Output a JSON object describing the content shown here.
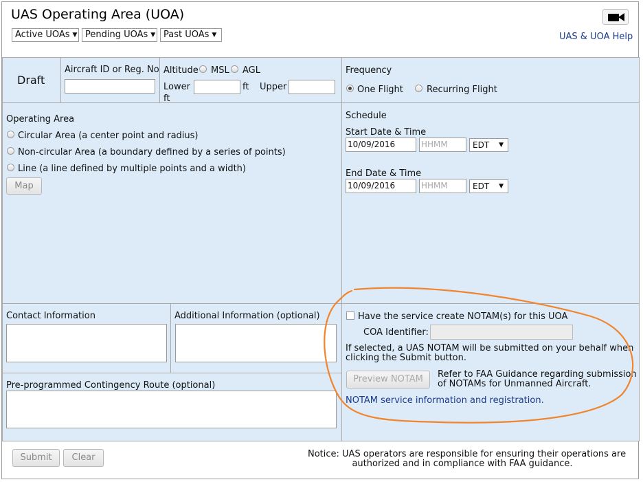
{
  "header": {
    "title": "UAS Operating Area (UOA)",
    "tabs": [
      {
        "label": "Active UOAs"
      },
      {
        "label": "Pending UOAs"
      },
      {
        "label": "Past UOAs"
      }
    ],
    "help_link": "UAS & UOA Help",
    "camera_icon": "video-camera-icon"
  },
  "status": {
    "label": "Draft"
  },
  "aircraft": {
    "label": "Aircraft ID or Reg. No.",
    "value": ""
  },
  "altitude": {
    "label": "Altitude",
    "options": [
      "MSL",
      "AGL"
    ],
    "lower_label": "Lower",
    "lower_unit": "ft",
    "upper_label": "Upper",
    "upper_unit": "ft",
    "lower_value": "",
    "upper_value": ""
  },
  "frequency": {
    "label": "Frequency",
    "options": [
      "One Flight",
      "Recurring Flight"
    ],
    "selected": "One Flight"
  },
  "operating_area": {
    "label": "Operating Area",
    "options": [
      "Circular Area (a center point and radius)",
      "Non-circular Area (a boundary defined by a series of points)",
      "Line (a line defined by multiple points and a width)"
    ],
    "map_button": "Map"
  },
  "schedule": {
    "label": "Schedule",
    "start_label": "Start Date & Time",
    "start_date": "10/09/2016",
    "start_time_placeholder": "HHMM",
    "start_tz": "EDT",
    "end_label": "End Date & Time",
    "end_date": "10/09/2016",
    "end_time_placeholder": "HHMM",
    "end_tz": "EDT"
  },
  "contact": {
    "label": "Contact Information",
    "value": ""
  },
  "additional": {
    "label": "Additional Information (optional)",
    "value": ""
  },
  "contingency": {
    "label": "Pre-programmed Contingency Route (optional)",
    "value": ""
  },
  "notam": {
    "checkbox_label": "Have the service create NOTAM(s) for this UOA",
    "coa_label": "COA Identifier:",
    "coa_value": "",
    "info_line1": "If selected, a UAS NOTAM will be submitted on your behalf when",
    "info_line2": "clicking the Submit button.",
    "preview_button": "Preview NOTAM",
    "guidance_line1": "Refer to FAA Guidance regarding submission",
    "guidance_line2": "of NOTAMs for Unmanned Aircraft.",
    "link": "NOTAM service information and registration.",
    "highlight_color": "#f0852d"
  },
  "footer": {
    "submit_button": "Submit",
    "clear_button": "Clear",
    "notice_line1": "Notice: UAS operators are responsible for ensuring their operations are",
    "notice_line2": "authorized and in compliance with FAA guidance."
  },
  "colors": {
    "panel": "#dcebf7",
    "link": "#1a3a8c"
  }
}
